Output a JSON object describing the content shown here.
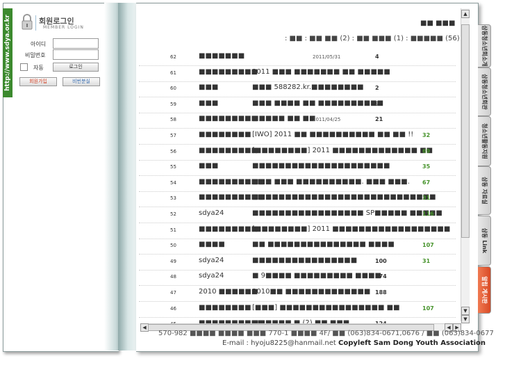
{
  "left_panel": {
    "url_text": "http://www.sdya.or.kr",
    "login_title": "회원로그인",
    "login_subtitle": "MEMBER LOGIN",
    "id_label": "아이디",
    "pw_label": "비밀번호",
    "auto_label": "자동",
    "login_button": "로그인",
    "join_button": "회원가입",
    "find_pw_button": "비번분실"
  },
  "board": {
    "title": "■■ ■■■",
    "pager": ": ■■ : ■■ ■■ (2) : ■■ ■■■ (1) : ■■■■■ (56) :",
    "rows": [
      {
        "num": "62",
        "author": "■■■■■■■",
        "subject": "",
        "date": "2011/05/31",
        "hits": "4",
        "comments": ""
      },
      {
        "num": "61",
        "author": "■■■■■■■■■",
        "subject": "2011 ■■■ ■■■■■■■ ■■ ■■■■■",
        "date": "",
        "hits": "",
        "comments": ""
      },
      {
        "num": "60",
        "author": "■■■",
        "subject": "■■■ 588282.kr.■■■■■■■■",
        "date": "",
        "hits": "2",
        "comments": ""
      },
      {
        "num": "59",
        "author": "■■■",
        "subject": "■■■ ■■■■ ■■ ■■■■■■■■■■",
        "date": "",
        "hits": "9",
        "comments": ""
      },
      {
        "num": "58",
        "author": "■■■■■■■■■",
        "subject": "■■■■■ ■■ ■■",
        "date": "2011/04/25",
        "hits": "21",
        "comments": ""
      },
      {
        "num": "57",
        "author": "■■■■■■■■",
        "subject": "[IWO] 2011 ■■ ■■■■■■■■■■ ■■ ■■ !!",
        "date": "",
        "hits": "",
        "comments": "32"
      },
      {
        "num": "56",
        "author": "■■■■■■■■■",
        "subject": "[■■■■■■■■] 2011 ■■■■■■■■■■■■■ ■■",
        "date": "",
        "hits": "",
        "comments": "69"
      },
      {
        "num": "55",
        "author": "■■■",
        "subject": "■■■■■■■■■■■■■■■■■■■■■",
        "date": "",
        "hits": "",
        "comments": "35"
      },
      {
        "num": "54",
        "author": "■■■■■■■■■■",
        "subject": "■■■ ■■■ ■■■■■■■■■■. ■■■ ■■■.",
        "date": "",
        "hits": "",
        "comments": "67"
      },
      {
        "num": "53",
        "author": "■■■■■■■■■■",
        "subject": "■■■■■■■■■■■■■■■■■■■■■■■■■■■■",
        "date": "",
        "hits": "",
        "comments": "31"
      },
      {
        "num": "52",
        "author": "sdya24",
        "subject": "■■■■■■■■■■■■■■■■■ SP■■■■■ ■■■■■",
        "date": "",
        "hits": "",
        "comments": "116"
      },
      {
        "num": "51",
        "author": "■■■■■■■■■",
        "subject": "[■■■■■■■■] 2011 ■■■■■■■■■■■■■■■■■■",
        "date": "",
        "hits": "",
        "comments": ""
      },
      {
        "num": "50",
        "author": "■■■■",
        "subject": "■■ ■■■■■■■■■■■■■■■ ■■■■",
        "date": "",
        "hits": "",
        "comments": "107"
      },
      {
        "num": "49",
        "author": "sdya24",
        "subject": "■■■■■■■■■■■■■■■■",
        "date": "",
        "hits": "100",
        "comments": "31"
      },
      {
        "num": "48",
        "author": "sdya24",
        "subject": "■ 9■■■■ ■■■■■■■■■ ■■■■",
        "date": "",
        "hits": "174",
        "comments": ""
      },
      {
        "num": "47",
        "author": "2010 ■■■■■■",
        "subject": "2010■■ ■■■■■■■■■■■■■",
        "date": "",
        "hits": "188",
        "comments": ""
      },
      {
        "num": "46",
        "author": "■■■■■■■■",
        "subject": "[■■■] ■■■■■■■■■■■■■■■■ ■■",
        "date": "",
        "hits": "",
        "comments": "107"
      },
      {
        "num": "45",
        "author": "■■■■■■■■■■",
        "subject": "■■■■■■ ■ (2) ■■ ■■■",
        "date": "",
        "hits": "124",
        "comments": ""
      }
    ]
  },
  "footer": {
    "line1": "570-982 ■■■■ ■■■■ ■■■ 770-1 ■■■■ 4F/ ■■ (063)834-0671,0676 / ■■ (063)834-0677",
    "email": "E-mail : hyoju8225@hanmail.net",
    "copyleft": "Copyleft Sam Dong Youth Association"
  },
  "tabs": [
    {
      "label": "삼동청소년회소개"
    },
    {
      "label": "삼동청소년회관"
    },
    {
      "label": "청소년활동지원"
    },
    {
      "label": "삼동 자료실"
    },
    {
      "label": "삼동 Link"
    },
    {
      "label": "알립 게시판"
    }
  ],
  "colors": {
    "accent_green": "#3c8a2e",
    "comment_green": "#46932b",
    "active_tab": "#d94b26"
  }
}
